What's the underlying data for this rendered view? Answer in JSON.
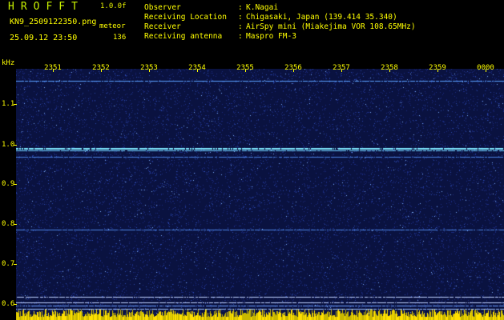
{
  "app": {
    "title": "HROFFT",
    "version": "1.0.0f"
  },
  "file": {
    "name": "KN9_2509122350.png",
    "timestamp": "25.09.12 23:50",
    "mode": "meteor",
    "count": "136"
  },
  "info": [
    {
      "label": "Observer",
      "value": "K.Nagai"
    },
    {
      "label": "Receiving Location",
      "value": "Chigasaki, Japan (139.414 35.340)"
    },
    {
      "label": "Receiver",
      "value": "AirSpy mini (Miakejima VOR 108.65MHz)"
    },
    {
      "label": "Receiving antenna",
      "value": "Maspro FM-3"
    }
  ],
  "separator": ":",
  "axis": {
    "y_unit": "kHz",
    "x_ticks": [
      "2351",
      "2352",
      "2353",
      "2354",
      "2355",
      "2356",
      "2357",
      "2358",
      "2359",
      "0000"
    ],
    "y_ticks": [
      "1.1",
      "1.0",
      "0.9",
      "0.8",
      "0.7",
      "0.6"
    ]
  },
  "colors": {
    "text": "#ffff00",
    "background": "#000000",
    "spectrogram_bg": "#0a1240",
    "signal": "#7fe8ff"
  }
}
